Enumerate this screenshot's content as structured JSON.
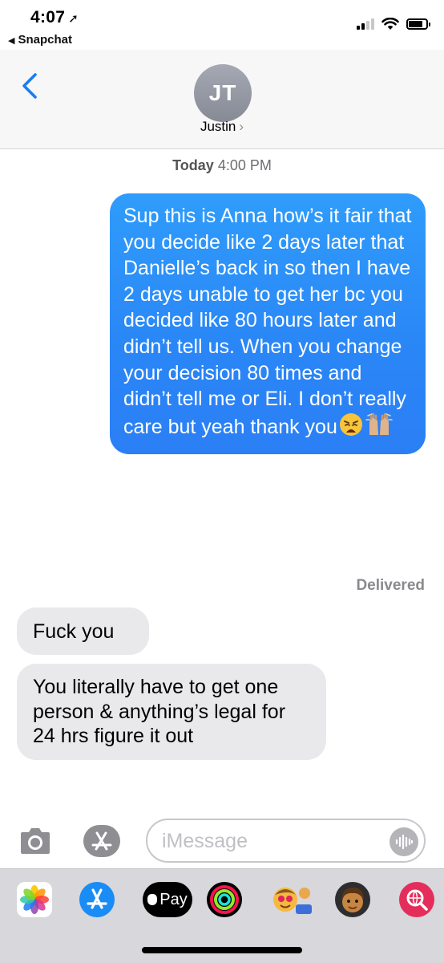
{
  "status_bar": {
    "time": "4:07",
    "location_glyph": "➚",
    "back_app": "Snapchat",
    "back_glyph": "◀"
  },
  "header": {
    "avatar_initials": "JT",
    "contact_name": "Justin",
    "contact_chevron": "›"
  },
  "conversation": {
    "timestamp_day": "Today",
    "timestamp_time": "4:00 PM",
    "sent": {
      "text": "Sup this is Anna how’s it fair that you decide like 2 days later that Danielle’s back in so then I have 2 days unable to get her bc you decided like 80 hours later and didn’t tell us. When you change your decision 80 times and didn’t tell me or Eli. I don’t really care but yeah thank you"
    },
    "delivered_label": "Delivered",
    "received": [
      {
        "text": "Fuck you"
      },
      {
        "text": "You literally have to get one person & anything’s legal for 24 hrs figure it out"
      }
    ]
  },
  "input": {
    "placeholder": "iMessage"
  },
  "drawer": {
    "apple_pay_label": "Pay"
  },
  "colors": {
    "sent_bubble": "#2a86f6",
    "received_bubble": "#e9e9eb",
    "accent_blue": "#1a7cf5",
    "drawer_bg": "#d7d7dc"
  },
  "icons": [
    "back-chevron-icon",
    "location-arrow-icon",
    "signal-icon",
    "wifi-icon",
    "battery-icon",
    "camera-icon",
    "app-store-icon",
    "audio-waveform-icon",
    "photos-app-icon",
    "app-store-app-icon",
    "apple-pay-app-icon",
    "activity-app-icon",
    "animoji-app-icon",
    "memoji-app-icon",
    "web-search-app-icon"
  ]
}
